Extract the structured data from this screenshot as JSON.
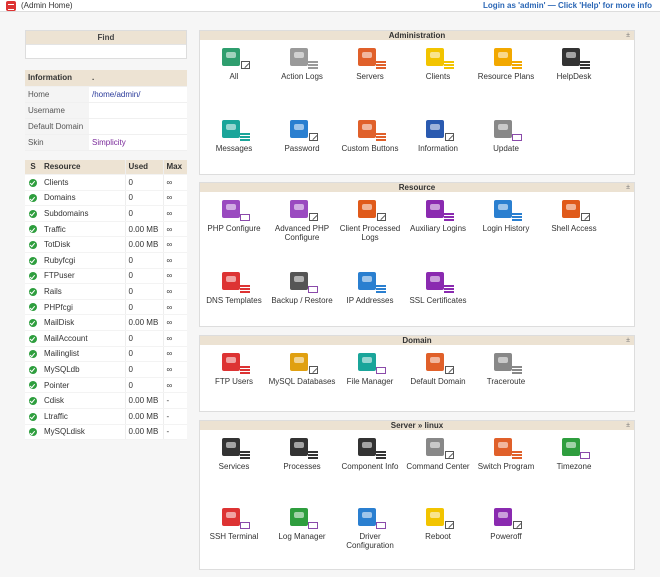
{
  "topbar": {
    "title": "(Admin Home)",
    "login": "Login as 'admin' — Click 'Help' for more info"
  },
  "find": {
    "title": "Find"
  },
  "information": {
    "header": [
      "Information",
      "."
    ],
    "rows": [
      {
        "k": "Home",
        "v": "/home/admin/"
      },
      {
        "k": "Username",
        "v": ""
      },
      {
        "k": "Default Domain",
        "v": ""
      },
      {
        "k": "Skin",
        "v": "Simplicity"
      }
    ]
  },
  "resources": {
    "header": [
      "S",
      "Resource",
      "Used",
      "Max"
    ],
    "rows": [
      {
        "name": "Clients",
        "used": "0",
        "max": "∞"
      },
      {
        "name": "Domains",
        "used": "0",
        "max": "∞"
      },
      {
        "name": "Subdomains",
        "used": "0",
        "max": "∞"
      },
      {
        "name": "Traffic",
        "used": "0.00 MB",
        "max": "∞"
      },
      {
        "name": "TotDisk",
        "used": "0.00 MB",
        "max": "∞"
      },
      {
        "name": "Rubyfcgi",
        "used": "0",
        "max": "∞"
      },
      {
        "name": "FTPuser",
        "used": "0",
        "max": "∞"
      },
      {
        "name": "Rails",
        "used": "0",
        "max": "∞"
      },
      {
        "name": "PHPfcgi",
        "used": "0",
        "max": "∞"
      },
      {
        "name": "MailDisk",
        "used": "0.00 MB",
        "max": "∞"
      },
      {
        "name": "MailAccount",
        "used": "0",
        "max": "∞"
      },
      {
        "name": "Mailinglist",
        "used": "0",
        "max": "∞"
      },
      {
        "name": "MySQLdb",
        "used": "0",
        "max": "∞"
      },
      {
        "name": "Pointer",
        "used": "0",
        "max": "∞"
      },
      {
        "name": "Cdisk",
        "used": "0.00 MB",
        "max": "-"
      },
      {
        "name": "Ltraffic",
        "used": "0.00 MB",
        "max": "-"
      },
      {
        "name": "MySQLdisk",
        "used": "0.00 MB",
        "max": "-"
      }
    ]
  },
  "panels": [
    {
      "title": "Administration",
      "toggle": "±",
      "items": [
        {
          "label": "All",
          "icon": "users-icon",
          "color": "#2e9e6e",
          "sub": "edit"
        },
        {
          "label": "Action Logs",
          "icon": "action-logs-icon",
          "color": "#9a9a9a",
          "sub": "list"
        },
        {
          "label": "Servers",
          "icon": "servers-icon",
          "color": "#e0602a",
          "sub": "list"
        },
        {
          "label": "Clients",
          "icon": "clients-icon",
          "color": "#f2c400",
          "sub": "list"
        },
        {
          "label": "Resource Plans",
          "icon": "resource-plans-icon",
          "color": "#f2a800",
          "sub": "list"
        },
        {
          "label": "HelpDesk",
          "icon": "helpdesk-icon",
          "color": "#333",
          "sub": "list"
        },
        {
          "label": "Messages",
          "icon": "messages-icon",
          "color": "#1aa59a",
          "sub": "list"
        },
        {
          "label": "Password",
          "icon": "password-icon",
          "color": "#2a7fd0",
          "sub": "edit"
        },
        {
          "label": "Custom Buttons",
          "icon": "custom-buttons-icon",
          "color": "#e0602a",
          "sub": "list"
        },
        {
          "label": "Information",
          "icon": "information-icon",
          "color": "#2a5ab0",
          "sub": "edit"
        },
        {
          "label": "Update",
          "icon": "update-icon",
          "color": "#888",
          "sub": "tv"
        }
      ]
    },
    {
      "title": "Resource",
      "toggle": "±",
      "items": [
        {
          "label": "PHP Configure",
          "icon": "php-icon",
          "color": "#9a4ac0",
          "sub": "tv"
        },
        {
          "label": "Advanced PHP Configure",
          "icon": "php-advanced-icon",
          "color": "#9a4ac0",
          "sub": "edit"
        },
        {
          "label": "Client Processed Logs",
          "icon": "processed-logs-icon",
          "color": "#e05a1a",
          "sub": "edit"
        },
        {
          "label": "Auxiliary Logins",
          "icon": "auxiliary-logins-icon",
          "color": "#8a2ab0",
          "sub": "list"
        },
        {
          "label": "Login History",
          "icon": "login-history-icon",
          "color": "#2a7fd0",
          "sub": "list"
        },
        {
          "label": "Shell Access",
          "icon": "shell-access-icon",
          "color": "#e05a1a",
          "sub": "edit"
        },
        {
          "label": "DNS Templates",
          "icon": "dns-templates-icon",
          "color": "#d33",
          "sub": "list"
        },
        {
          "label": "Backup / Restore",
          "icon": "backup-restore-icon",
          "color": "#555",
          "sub": "tv"
        },
        {
          "label": "IP Addresses",
          "icon": "ip-addresses-icon",
          "color": "#2a7fd0",
          "sub": "list"
        },
        {
          "label": "SSL Certificates",
          "icon": "ssl-certificates-icon",
          "color": "#8a2ab0",
          "sub": "list"
        }
      ]
    },
    {
      "title": "Domain",
      "toggle": "±",
      "items": [
        {
          "label": "FTP Users",
          "icon": "ftp-users-icon",
          "color": "#d33",
          "sub": "list"
        },
        {
          "label": "MySQL Databases",
          "icon": "mysql-databases-icon",
          "color": "#e0a010",
          "sub": "edit"
        },
        {
          "label": "File Manager",
          "icon": "file-manager-icon",
          "color": "#1aa59a",
          "sub": "tv"
        },
        {
          "label": "Default Domain",
          "icon": "default-domain-icon",
          "color": "#e0602a",
          "sub": "edit"
        },
        {
          "label": "Traceroute",
          "icon": "traceroute-icon",
          "color": "#888",
          "sub": "list"
        }
      ]
    },
    {
      "title": "Server » linux",
      "toggle": "±",
      "items": [
        {
          "label": "Services",
          "icon": "services-icon",
          "color": "#333",
          "sub": "list"
        },
        {
          "label": "Processes",
          "icon": "processes-icon",
          "color": "#333",
          "sub": "list"
        },
        {
          "label": "Component Info",
          "icon": "component-info-icon",
          "color": "#333",
          "sub": "list"
        },
        {
          "label": "Command Center",
          "icon": "command-center-icon",
          "color": "#888",
          "sub": "edit"
        },
        {
          "label": "Switch Program",
          "icon": "switch-program-icon",
          "color": "#e0602a",
          "sub": "list"
        },
        {
          "label": "Timezone",
          "icon": "timezone-icon",
          "color": "#2e9e3e",
          "sub": "tv"
        },
        {
          "label": "SSH Terminal",
          "icon": "ssh-terminal-icon",
          "color": "#d33",
          "sub": "tv"
        },
        {
          "label": "Log Manager",
          "icon": "log-manager-icon",
          "color": "#2e9e3e",
          "sub": "tv"
        },
        {
          "label": "Driver Configuration",
          "icon": "driver-configuration-icon",
          "color": "#2a7fd0",
          "sub": "tv"
        },
        {
          "label": "Reboot",
          "icon": "reboot-icon",
          "color": "#f2c400",
          "sub": "edit"
        },
        {
          "label": "Poweroff",
          "icon": "poweroff-icon",
          "color": "#8a2ab0",
          "sub": "edit"
        }
      ]
    }
  ]
}
